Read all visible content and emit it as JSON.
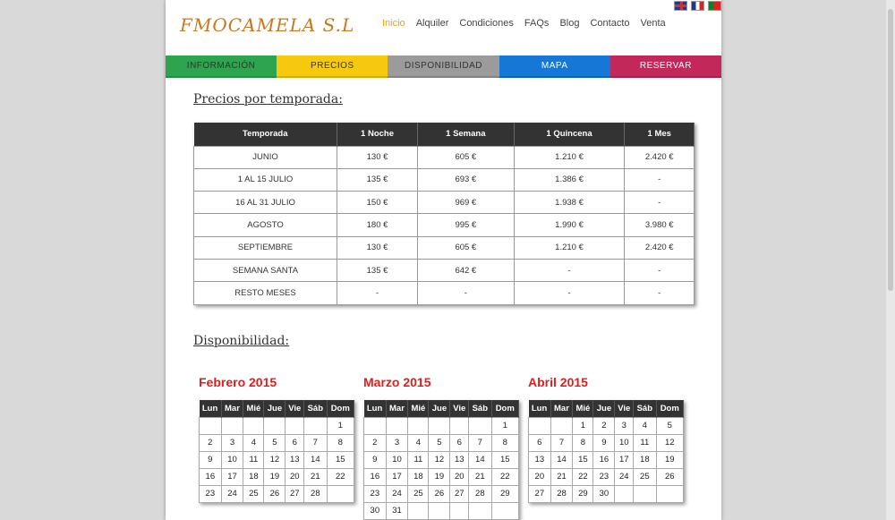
{
  "header": {
    "logo": "FMOCAMELA S.L",
    "nav": [
      "Inicio",
      "Alquiler",
      "Condiciones",
      "FAQs",
      "Blog",
      "Contacto",
      "Venta"
    ],
    "flags": [
      "english-flag",
      "french-flag",
      "portuguese-flag"
    ]
  },
  "tabs": [
    {
      "label": "INFORMACIÓN",
      "color": "#2ea44f",
      "text": "#333"
    },
    {
      "label": "PRECIOS",
      "color": "#f6c90e",
      "text": "#333"
    },
    {
      "label": "DISPONIBILIDAD",
      "color": "#9b9b9b",
      "text": "#333"
    },
    {
      "label": "MAPA",
      "color": "#1577d6",
      "text": "#fff"
    },
    {
      "label": "RESERVAR",
      "color": "#c2285a",
      "text": "#fff"
    }
  ],
  "prices": {
    "title": "Precios por temporada:",
    "headers": [
      "Temporada",
      "1 Noche",
      "1 Semana",
      "1 Quincena",
      "1 Mes"
    ],
    "rows": [
      [
        "JUNIO",
        "130 €",
        "605 €",
        "1.210 €",
        "2.420 €"
      ],
      [
        "1 AL 15 JULIO",
        "135 €",
        "693 €",
        "1.386 €",
        "-"
      ],
      [
        "16 AL 31 JULIO",
        "150 €",
        "969 €",
        "1.938 €",
        "-"
      ],
      [
        "AGOSTO",
        "180 €",
        "995 €",
        "1.990 €",
        "3.980 €"
      ],
      [
        "SEPTIEMBRE",
        "130 €",
        "605 €",
        "1.210 €",
        "2.420 €"
      ],
      [
        "SEMANA SANTA",
        "135 €",
        "642 €",
        "-",
        "-"
      ],
      [
        "RESTO MESES",
        "-",
        "-",
        "-",
        "-"
      ]
    ]
  },
  "availability": {
    "title": "Disponibilidad:",
    "days": [
      "Lun",
      "Mar",
      "Mié",
      "Jue",
      "Vie",
      "Sáb",
      "Dom"
    ],
    "months": [
      {
        "name": "Febrero 2015",
        "weeks": [
          [
            "",
            "",
            "",
            "",
            "",
            "",
            "1"
          ],
          [
            "2",
            "3",
            "4",
            "5",
            "6",
            "7",
            "8"
          ],
          [
            "9",
            "10",
            "11",
            "12",
            "13",
            "14",
            "15"
          ],
          [
            "16",
            "17",
            "18",
            "19",
            "20",
            "21",
            "22"
          ],
          [
            "23",
            "24",
            "25",
            "26",
            "27",
            "28",
            ""
          ]
        ]
      },
      {
        "name": "Marzo 2015",
        "weeks": [
          [
            "",
            "",
            "",
            "",
            "",
            "",
            "1"
          ],
          [
            "2",
            "3",
            "4",
            "5",
            "6",
            "7",
            "8"
          ],
          [
            "9",
            "10",
            "11",
            "12",
            "13",
            "14",
            "15"
          ],
          [
            "16",
            "17",
            "18",
            "19",
            "20",
            "21",
            "22"
          ],
          [
            "23",
            "24",
            "25",
            "26",
            "27",
            "28",
            "29"
          ],
          [
            "30",
            "31",
            "",
            "",
            "",
            "",
            ""
          ]
        ]
      },
      {
        "name": "Abril 2015",
        "weeks": [
          [
            "",
            "",
            "1",
            "2",
            "3",
            "4",
            "5"
          ],
          [
            "6",
            "7",
            "8",
            "9",
            "10",
            "11",
            "12"
          ],
          [
            "13",
            "14",
            "15",
            "16",
            "17",
            "18",
            "19"
          ],
          [
            "20",
            "21",
            "22",
            "23",
            "24",
            "25",
            "26"
          ],
          [
            "27",
            "28",
            "29",
            "30",
            "",
            "",
            ""
          ]
        ]
      }
    ]
  }
}
